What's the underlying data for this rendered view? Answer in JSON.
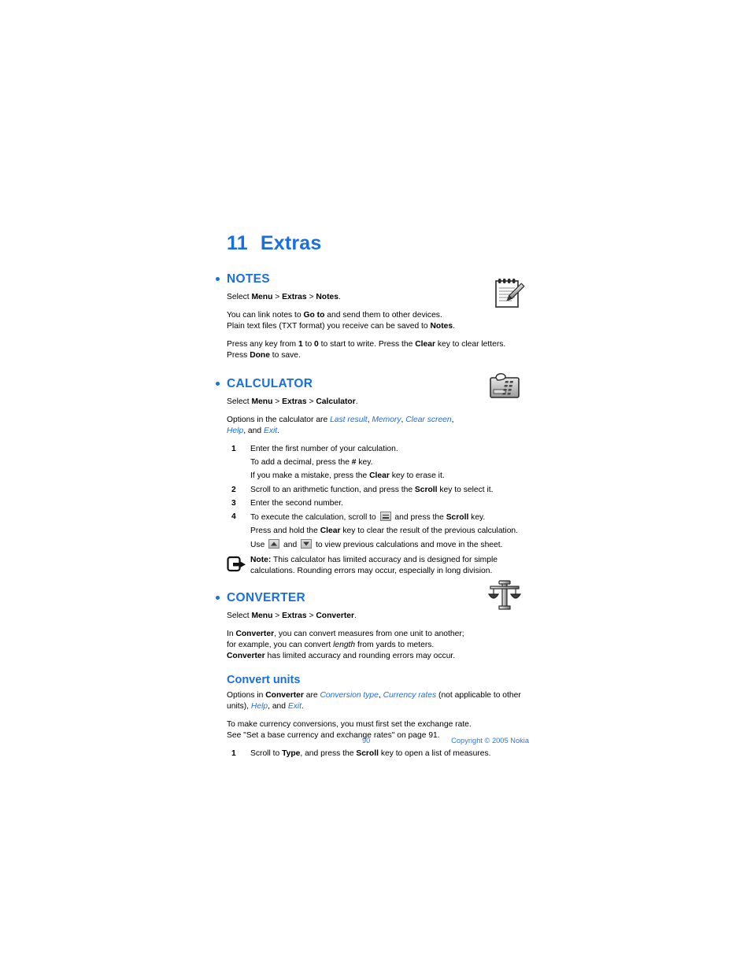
{
  "document": {
    "chapter_number": "11",
    "chapter_title": "Extras"
  },
  "colors": {
    "heading_blue": "#1a6fe0",
    "footer_blue": "#2b7ae4",
    "body_black": "#000000"
  },
  "sections": {
    "notes": {
      "heading": "NOTES",
      "icon": "notepad-pencil-icon",
      "select_path_prefix": "Select ",
      "select_menu": "Menu",
      "sep1": " > ",
      "select_extras": "Extras",
      "sep2": " > ",
      "select_item": "Notes",
      "select_end": ".",
      "para1_a": "You can link notes to ",
      "para1_b": "Go to",
      "para1_c": " and send them to other devices.",
      "para1_d": "Plain text files (TXT format) you receive can be saved to ",
      "para1_e": "Notes",
      "para1_f": ".",
      "para2_a": "Press any key from ",
      "para2_b": "1",
      "para2_c": " to ",
      "para2_d": "0",
      "para2_e": " to start to write. Press the ",
      "para2_f": "Clear",
      "para2_g": " key to clear letters.",
      "para2_h": "Press ",
      "para2_i": "Done",
      "para2_j": " to save."
    },
    "calculator": {
      "heading": "CALCULATOR",
      "icon": "calculator-icon",
      "select_prefix": "Select ",
      "select_menu": "Menu",
      "sep1": " > ",
      "select_extras": "Extras",
      "sep2": " > ",
      "select_item": "Calculator",
      "select_end": ".",
      "options_intro": "Options in the calculator are ",
      "option1": "Last result",
      "option_sep1": ", ",
      "option2": "Memory",
      "option_sep2": ", ",
      "option3": "Clear screen",
      "option_sep3": ",",
      "option4": "Help",
      "option_sep4": ", and ",
      "option5": "Exit",
      "options_end": ".",
      "steps": [
        {
          "num": "1",
          "text": "Enter the first number of your calculation."
        },
        {
          "num": "2",
          "text": "Scroll to an arithmetic function, and press the Scroll key to select it."
        },
        {
          "num": "3",
          "text": "Enter the second number."
        },
        {
          "num": "4",
          "text": "To execute the calculation, scroll to = and press the Scroll key."
        }
      ],
      "step1_sub1_a": "To add a decimal, press the ",
      "step1_sub1_b": "#",
      "step1_sub1_c": " key.",
      "step1_sub2_a": "If you make a mistake, press the ",
      "step1_sub2_b": "Clear",
      "step1_sub2_c": " key to erase it.",
      "step2_a": "Scroll to an arithmetic function, and press the ",
      "step2_b": "Scroll",
      "step2_c": " key to select it.",
      "step4_a": "To execute the calculation, scroll to ",
      "step4_icon": "equals-key-icon",
      "step4_b": " and press the ",
      "step4_c": "Scroll",
      "step4_d": " key.",
      "step4_sub1_a": "Press and hold the ",
      "step4_sub1_b": "Clear",
      "step4_sub1_c": " key to clear the result of the previous calculation.",
      "step4_sub2_a": "Use ",
      "step4_sub2_icon_up": "scroll-up-key-icon",
      "step4_sub2_b": " and ",
      "step4_sub2_icon_down": "scroll-down-key-icon",
      "step4_sub2_c": " to view previous calculations and move in the sheet.",
      "note_icon": "note-pointer-icon",
      "note_label": "Note:",
      "note_text": " This calculator has limited accuracy and is designed for simple calculations. Rounding errors may occur, especially in long division."
    },
    "converter": {
      "heading": "CONVERTER",
      "icon": "balance-scale-icon",
      "select_prefix": "Select ",
      "select_menu": "Menu",
      "sep1": " > ",
      "select_extras": "Extras",
      "sep2": " > ",
      "select_item": "Converter",
      "select_end": ".",
      "para_a": "In ",
      "para_b": "Converter",
      "para_c": ", you can convert measures from one unit to another;",
      "para_d": "for example, you can convert ",
      "para_e": "length",
      "para_f": " from yards to meters.",
      "para_g": "Converter",
      "para_h": " has limited accuracy and rounding errors may occur.",
      "subsection": {
        "heading": "Convert units",
        "options_a": "Options in ",
        "options_b": "Converter",
        "options_c": " are ",
        "option1": "Conversion type",
        "option_sep1": ", ",
        "option2": "Currency rates",
        "options_d": " (not applicable to other units), ",
        "option3": "Help",
        "options_e": ", and ",
        "option4": "Exit",
        "options_end": ".",
        "para_a": "To make currency conversions, you must first set the exchange rate.",
        "para_b": "See \"Set a base currency and exchange rates\" on page 91.",
        "step1_num": "1",
        "step1_a": "Scroll to ",
        "step1_b": "Type",
        "step1_c": ", and press the ",
        "step1_d": "Scroll",
        "step1_e": " key to open a list of measures."
      }
    }
  },
  "footer": {
    "page_number": "90",
    "copyright": "Copyright © 2005 Nokia"
  }
}
